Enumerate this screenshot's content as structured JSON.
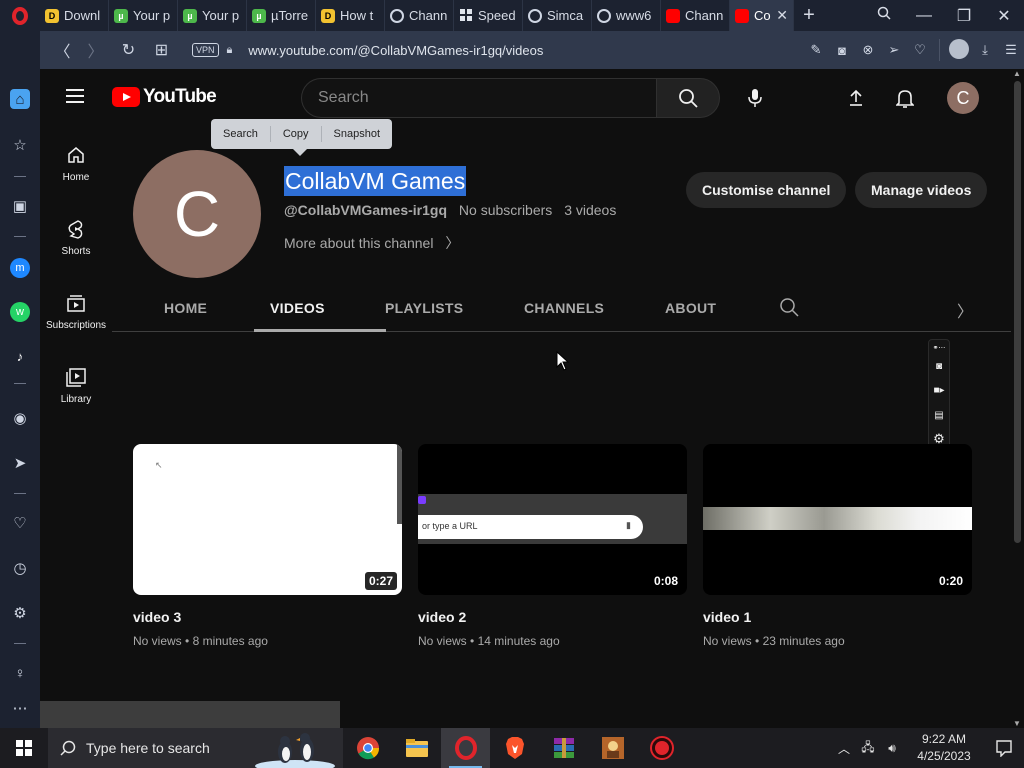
{
  "browser": {
    "tabs": [
      {
        "label": "Downl",
        "icon": "y-yellow"
      },
      {
        "label": "Your p",
        "icon": "g-green"
      },
      {
        "label": "Your p",
        "icon": "g-green"
      },
      {
        "label": "µTorre",
        "icon": "g-green"
      },
      {
        "label": "How t",
        "icon": "y-yellow"
      },
      {
        "label": "Chann",
        "icon": "globe"
      },
      {
        "label": "Speed",
        "icon": "grid"
      },
      {
        "label": "Simca",
        "icon": "globe"
      },
      {
        "label": "www6",
        "icon": "globe"
      },
      {
        "label": "Chann",
        "icon": "yt"
      },
      {
        "label": "Co",
        "icon": "yt",
        "active": true
      }
    ],
    "vpn_label": "VPN",
    "url": "www.youtube.com/@CollabVMGames-ir1gq/videos"
  },
  "youtube": {
    "logo_text": "YouTube",
    "search_placeholder": "Search",
    "avatar_letter": "C",
    "selection_popup": [
      "Search",
      "Copy",
      "Snapshot"
    ],
    "guide": [
      {
        "label": "Home",
        "icon": "home-icon"
      },
      {
        "label": "Shorts",
        "icon": "shorts-icon"
      },
      {
        "label": "Subscriptions",
        "icon": "subscriptions-icon"
      },
      {
        "label": "Library",
        "icon": "library-icon"
      }
    ],
    "channel": {
      "avatar_letter": "C",
      "name": "CollabVM Games",
      "handle": "@CollabVMGames-ir1gq",
      "subscribers": "No subscribers",
      "video_count": "3 videos",
      "more_link": "More about this channel",
      "customise_label": "Customise channel",
      "manage_label": "Manage videos"
    },
    "tabs": [
      "HOME",
      "VIDEOS",
      "PLAYLISTS",
      "CHANNELS",
      "ABOUT"
    ],
    "active_tab": "VIDEOS",
    "videos": [
      {
        "title": "video 3",
        "duration": "0:27",
        "views": "No views",
        "age": "8 minutes ago"
      },
      {
        "title": "video 2",
        "duration": "0:08",
        "views": "No views",
        "age": "14 minutes ago",
        "thumb_text": "or type a URL"
      },
      {
        "title": "video 1",
        "duration": "0:20",
        "views": "No views",
        "age": "23 minutes ago"
      }
    ]
  },
  "taskbar": {
    "search_placeholder": "Type here to search",
    "time": "9:22 AM",
    "date": "4/25/2023"
  },
  "colors": {
    "accent_red": "#ff0000",
    "selection_blue": "#2e6fd6",
    "avatar_brown": "#8d6e63",
    "opera_red": "#e0242b"
  }
}
